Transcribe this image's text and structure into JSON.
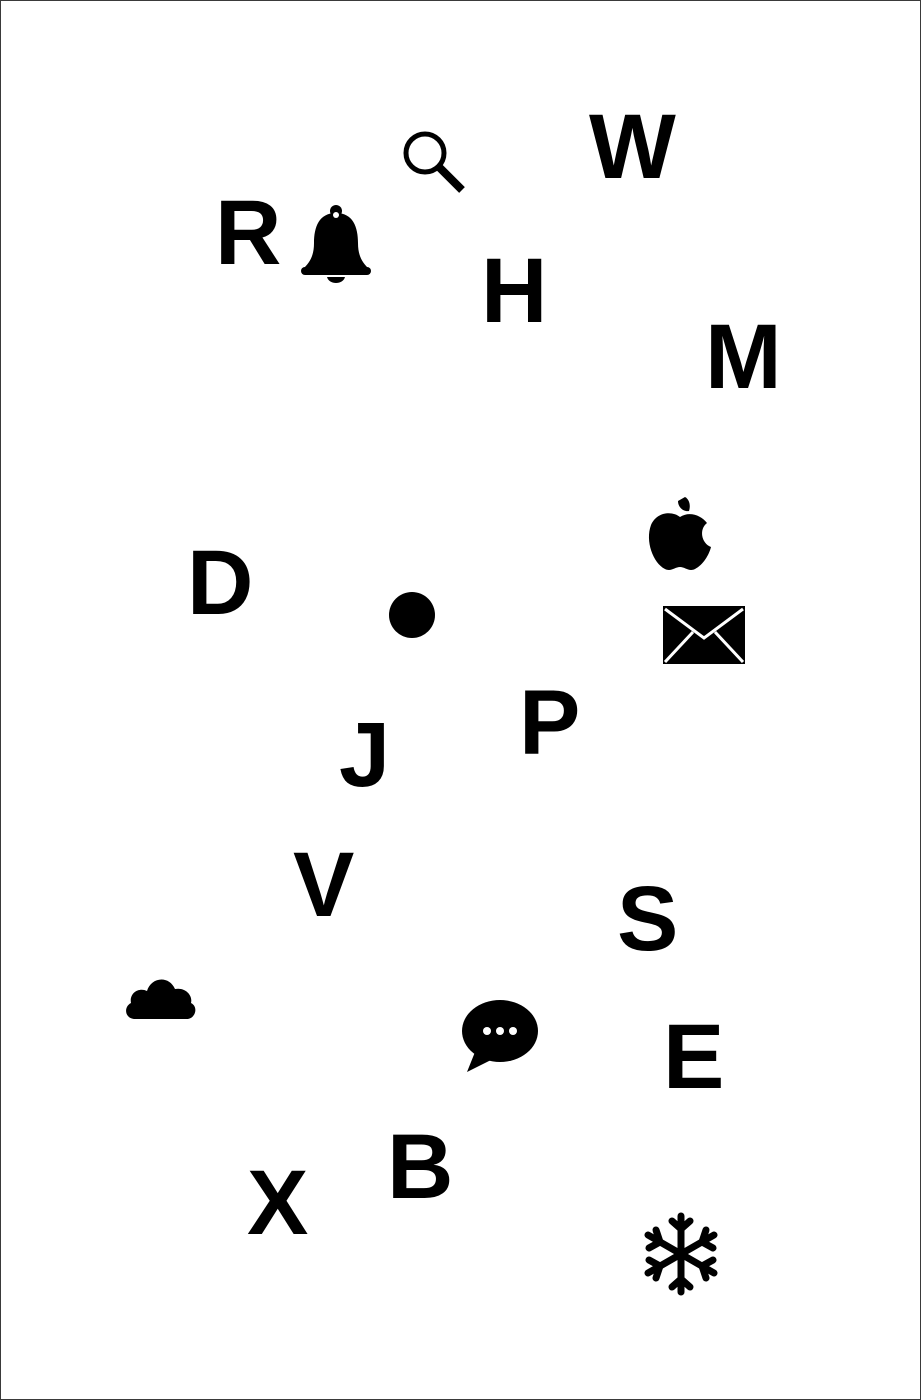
{
  "game": {
    "letters": {
      "R": "R",
      "W": "W",
      "H": "H",
      "M": "M",
      "D": "D",
      "P": "P",
      "J": "J",
      "V": "V",
      "S": "S",
      "E": "E",
      "B": "B",
      "X": "X"
    },
    "icons": [
      "search-icon",
      "bell-icon",
      "apple-icon",
      "dot-icon",
      "mail-icon",
      "cloud-icon",
      "chat-bubble-icon",
      "snowflake-icon"
    ],
    "colors": {
      "background": "#ffffff",
      "foreground": "#000000",
      "border": "#3a3a3a"
    }
  }
}
